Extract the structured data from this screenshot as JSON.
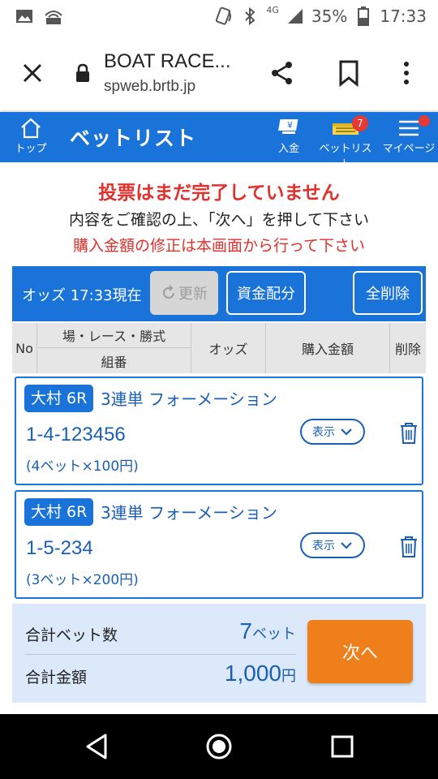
{
  "status_bar": {
    "network": "4G",
    "battery": "35%",
    "time": "17:33",
    "icons": [
      "image-icon",
      "signal-icon",
      "nfc-icon",
      "bluetooth-icon",
      "cellular-icon",
      "battery-icon"
    ]
  },
  "browser": {
    "title": "BOAT RACE...",
    "url": "spweb.brtb.jp"
  },
  "header": {
    "home_label": "トップ",
    "page_title": "ベットリスト",
    "deposit_label": "入金",
    "betlist_label": "ベットリスト",
    "betlist_badge": "7",
    "mypage_label": "マイページ",
    "accent": "#1a73d9"
  },
  "messages": {
    "not_complete": "投票はまだ完了していません",
    "confirm": "内容をご確認の上、「次へ」を押して下さい",
    "fix_amount": "購入金額の修正は本画面から行って下さい"
  },
  "toolbar": {
    "odds_time": "オッズ 17:33現在",
    "refresh_label": "更新",
    "allocate_label": "資金配分",
    "clear_all_label": "全削除"
  },
  "table_header": {
    "no": "No",
    "place_race_type": "場・レース・勝式",
    "combination": "組番",
    "odds": "オッズ",
    "amount": "購入金額",
    "delete": "削除"
  },
  "bets": [
    {
      "venue": "大村 6R",
      "type": "3連単 フォーメーション",
      "combination": "1-4-123456",
      "count_text": "(4ベット×100円)",
      "show_label": "表示"
    },
    {
      "venue": "大村 6R",
      "type": "3連単 フォーメーション",
      "combination": "1-5-234",
      "count_text": "(3ベット×200円)",
      "show_label": "表示"
    }
  ],
  "summary": {
    "total_bets_label": "合計ベット数",
    "total_bets_value": "7",
    "total_bets_unit": "ベット",
    "total_amount_label": "合計金額",
    "total_amount_value": "1,000",
    "total_amount_unit": "円",
    "next_label": "次へ"
  },
  "colors": {
    "primary": "#1a73d9",
    "alert": "#e0312d",
    "next_button": "#ef7f1a",
    "summary_bg": "#dbe9fa"
  }
}
